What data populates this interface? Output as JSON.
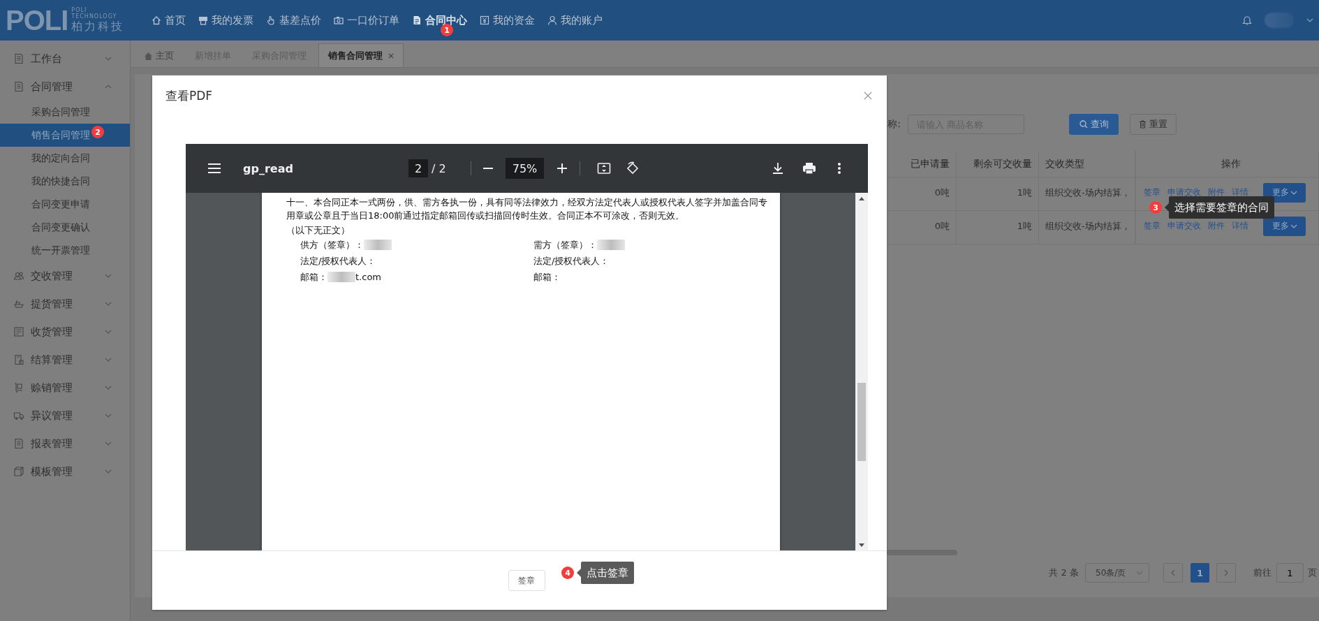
{
  "top_nav": {
    "logo": {
      "mark": "POLI",
      "subtitle": [
        "POLI",
        "TECHNOLOGY"
      ],
      "name": "柏力科技"
    },
    "items": [
      {
        "label": "首页",
        "selected": false
      },
      {
        "label": "我的发票",
        "selected": false
      },
      {
        "label": "基差点价",
        "selected": false
      },
      {
        "label": "一口价订单",
        "selected": false
      },
      {
        "label": "合同中心",
        "selected": true
      },
      {
        "label": "我的资金",
        "selected": false
      },
      {
        "label": "我的账户",
        "selected": false
      }
    ]
  },
  "sidebar": {
    "items": [
      {
        "label": "工作台",
        "expanded": false
      },
      {
        "label": "合同管理",
        "expanded": true,
        "children": [
          {
            "label": "采购合同管理",
            "selected": false
          },
          {
            "label": "销售合同管理",
            "selected": true
          },
          {
            "label": "我的定向合同",
            "selected": false
          },
          {
            "label": "我的快捷合同",
            "selected": false
          },
          {
            "label": "合同变更申请",
            "selected": false
          },
          {
            "label": "合同变更确认",
            "selected": false
          },
          {
            "label": "统一开票管理",
            "selected": false
          }
        ]
      },
      {
        "label": "交收管理",
        "expanded": false
      },
      {
        "label": "提货管理",
        "expanded": false
      },
      {
        "label": "收货管理",
        "expanded": false
      },
      {
        "label": "结算管理",
        "expanded": false
      },
      {
        "label": "赊销管理",
        "expanded": false
      },
      {
        "label": "异议管理",
        "expanded": false
      },
      {
        "label": "报表管理",
        "expanded": false
      },
      {
        "label": "模板管理",
        "expanded": false
      }
    ]
  },
  "tabs": [
    {
      "kind": "home",
      "label": "主页",
      "selected": false,
      "closable": false
    },
    {
      "kind": "page",
      "label": "新增挂单",
      "selected": false,
      "closable": false
    },
    {
      "kind": "page",
      "label": "采购合同管理",
      "selected": false,
      "closable": false
    },
    {
      "kind": "page",
      "label": "销售合同管理",
      "selected": true,
      "closable": true
    }
  ],
  "search": {
    "label": "称:",
    "placeholder": "请输入 商品名称",
    "query_button": "查询",
    "reset_button": "重置"
  },
  "table": {
    "columns": [
      "已申请量",
      "剩余可交收量",
      "交收类型",
      "操作"
    ],
    "rows": [
      {
        "cells": [
          "0吨",
          "1吨",
          "组织交收-场内结算，"
        ],
        "actions": [
          "签章",
          "申请交收",
          "附件",
          "详情"
        ],
        "more": "更多"
      },
      {
        "cells": [
          "0吨",
          "1吨",
          "组织交收-场内结算，"
        ],
        "actions": [
          "签章",
          "申请交收",
          "附件",
          "详情"
        ],
        "more": "更多"
      }
    ]
  },
  "pagination": {
    "total": "共 2 条",
    "page_size": "50条/页",
    "pages": [
      {
        "label": "1",
        "selected": true
      }
    ],
    "goto_label": "前往",
    "goto_value": "1",
    "page_suffix": "页"
  },
  "modal": {
    "title": "查看PDF",
    "viewer": {
      "title": "gp_read",
      "page": "2",
      "page_total": "/ 2",
      "zoom": "75%"
    },
    "page_lines": [
      {
        "kind": "text",
        "text": "十一、本合同正本一式两份，供、需方各执一份，具有同等法律效力，经双方法定代表人或授权代表人签字并加盖合同专"
      },
      {
        "kind": "text",
        "text": "用章或公章且于当日18:00前通过指定邮箱回传或扫描回传时生效。合同正本不可涂改，否则无效。"
      },
      {
        "kind": "text",
        "text": "（以下无正文）"
      },
      {
        "kind": "pair",
        "left": {
          "label": "供方（签章）：",
          "redacted": true
        },
        "right": {
          "label": "需方（签章）：",
          "redacted": true
        }
      },
      {
        "kind": "pair",
        "left": {
          "label": "法定/授权代表人："
        },
        "right": {
          "label": "法定/授权代表人："
        }
      },
      {
        "kind": "pair",
        "left": {
          "label": "邮箱：",
          "redacted": true,
          "value": "t.com"
        },
        "right": {
          "label": "邮箱："
        }
      }
    ],
    "sign_button": "签章"
  },
  "steps": [
    {
      "number": "1"
    },
    {
      "number": "2"
    },
    {
      "number": "3",
      "tip": "选择需要签章的合同"
    },
    {
      "number": "4",
      "tip": "点击签章"
    }
  ]
}
